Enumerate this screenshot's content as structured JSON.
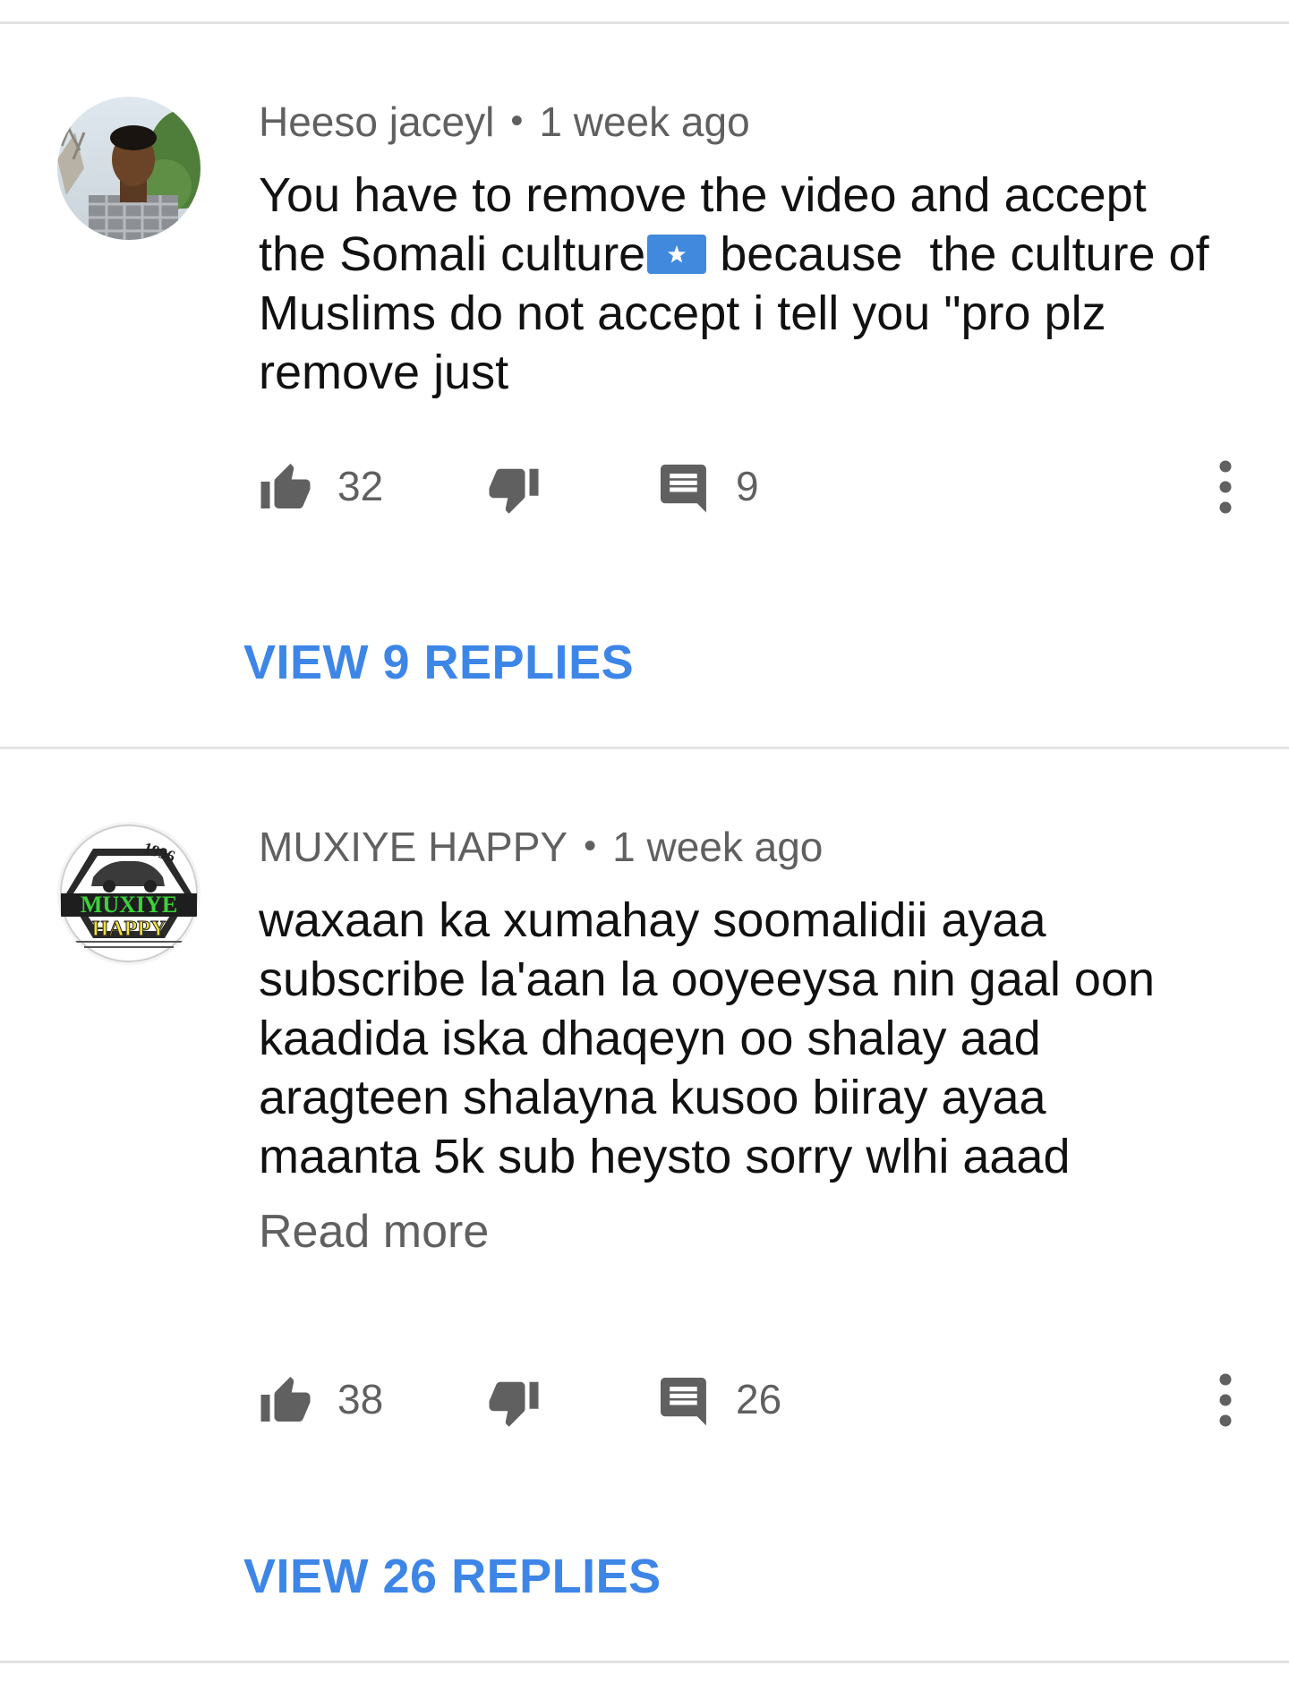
{
  "comments": [
    {
      "author": "Heeso jaceyl",
      "separator": "•",
      "time": "1 week ago",
      "text_before_flag": "You have to remove the video and accept the Somali culture",
      "flag_icon": "somalia-flag-icon",
      "text_after_flag": " because  the culture of Muslims do not accept i tell you \"pro plz remove just",
      "likes": "32",
      "replies_count": "9",
      "view_replies_label": "VIEW 9 REPLIES"
    },
    {
      "author": "MUXIYE HAPPY",
      "separator": "•",
      "time": "1 week ago",
      "text": "waxaan ka xumahay soomalidii ayaa subscribe la'aan la ooyeeysa nin gaal oon kaadida iska dhaqeyn oo shalay aad aragteen shalayna kusoo biiray ayaa maanta 5k sub heysto sorry wlhi aaad",
      "read_more_label": "Read more",
      "avatar_logo_year": "1996",
      "avatar_logo_line1": "MUXIYE",
      "avatar_logo_line2": "HAPPY",
      "likes": "38",
      "replies_count": "26",
      "view_replies_label": "VIEW 26 REPLIES"
    }
  ],
  "colors": {
    "link_blue": "#3d86e8",
    "meta_gray": "#606060",
    "icon_gray": "#606060",
    "divider": "#e3e3e3",
    "flag_blue": "#4189dd"
  },
  "icons": [
    "thumb-up-icon",
    "thumb-down-icon",
    "comment-icon",
    "more-vertical-icon"
  ]
}
